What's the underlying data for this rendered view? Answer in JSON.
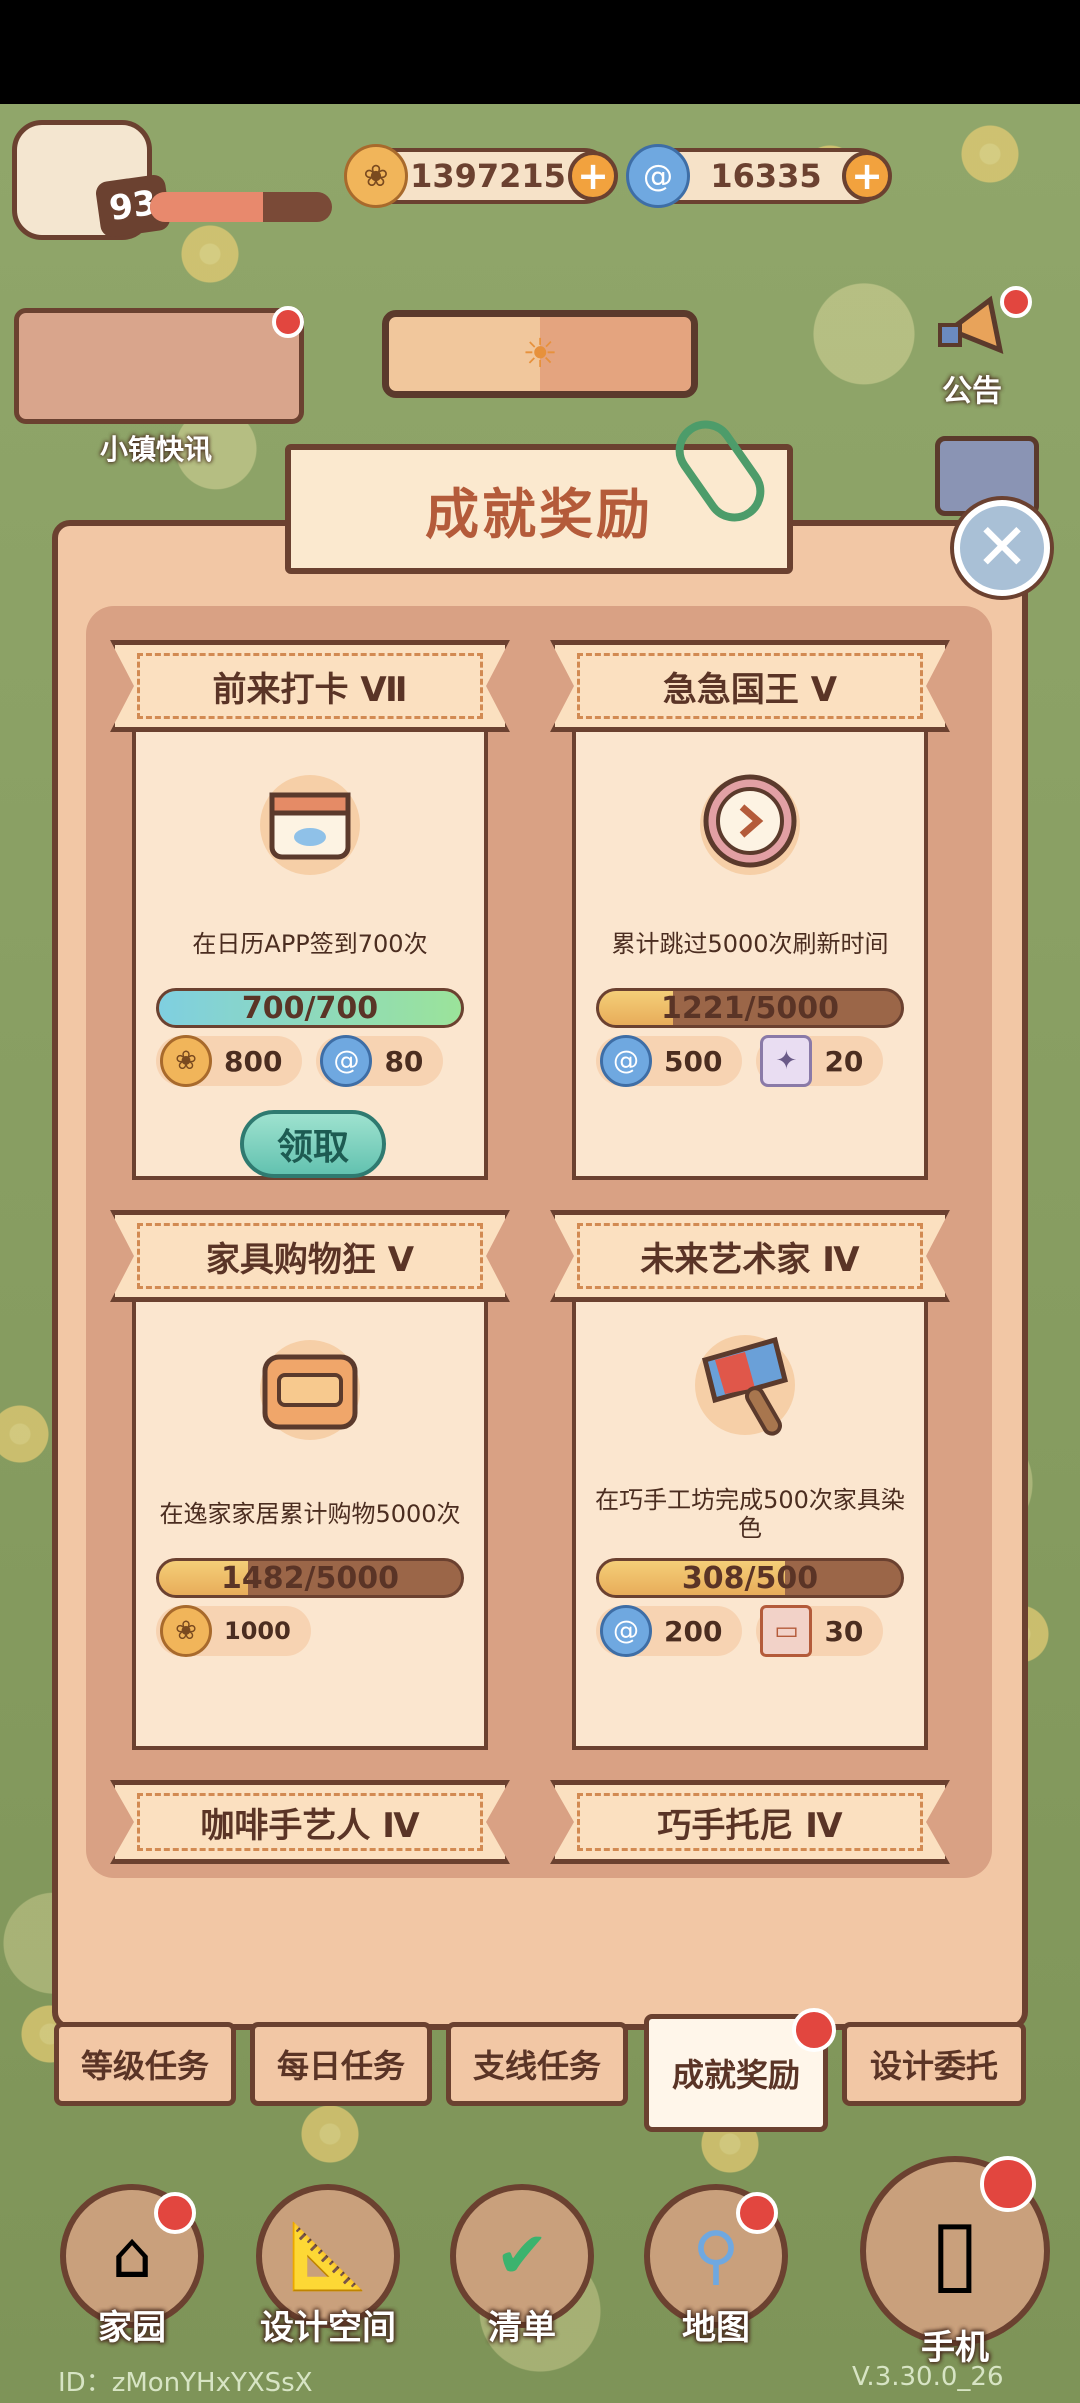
{
  "hud": {
    "level": "93",
    "xp_fraction": 0.62,
    "coins": "1397215",
    "gems": "16335",
    "plus_glyph": "+"
  },
  "side": {
    "news_label": "小镇快讯",
    "announce_label": "公告"
  },
  "panel": {
    "title": "成就奖励",
    "close_glyph": "✕"
  },
  "achievements": [
    {
      "name": "前来打卡 Ⅶ",
      "icon": "calendar-icon",
      "desc": "在日历APP签到700次",
      "progress_text": "700/700",
      "progress_fraction": 1.0,
      "completed": true,
      "rewards": [
        {
          "icon": "coin-icon",
          "amount": "800"
        },
        {
          "icon": "swirl-gem-icon",
          "amount": "80"
        }
      ],
      "claim_label": "领取"
    },
    {
      "name": "急急国王 Ⅴ",
      "icon": "clock-icon",
      "desc": "累计跳过5000次刷新时间",
      "progress_text": "1221/5000",
      "progress_fraction": 0.244,
      "completed": false,
      "rewards": [
        {
          "icon": "swirl-gem-icon",
          "amount": "500"
        },
        {
          "icon": "ticket-icon",
          "amount": "20"
        }
      ]
    },
    {
      "name": "家具购物狂 Ⅴ",
      "icon": "armchair-icon",
      "desc": "在逸家家居累计购物5000次",
      "progress_text": "1482/5000",
      "progress_fraction": 0.296,
      "completed": false,
      "rewards": [
        {
          "icon": "coin-icon",
          "amount": "1000"
        }
      ]
    },
    {
      "name": "未来艺术家 Ⅳ",
      "icon": "paintbrush-icon",
      "desc": "在巧手工坊完成500次家具染色",
      "progress_text": "308/500",
      "progress_fraction": 0.616,
      "completed": false,
      "rewards": [
        {
          "icon": "swirl-gem-icon",
          "amount": "200"
        },
        {
          "icon": "coupon-icon",
          "amount": "30"
        }
      ]
    },
    {
      "name": "咖啡手艺人 Ⅳ"
    },
    {
      "name": "巧手托尼 Ⅳ"
    }
  ],
  "tabs": [
    "等级任务",
    "每日任务",
    "支线任务",
    "成就奖励",
    "设计委托"
  ],
  "active_tab": "成就奖励",
  "nav": [
    "家园",
    "设计空间",
    "清单",
    "地图",
    "手机"
  ],
  "footer": {
    "id": "ID：zMonYHxYXSsX",
    "version": "V.3.30.0_26"
  },
  "colors": {
    "panel": "#f2c7a5",
    "border": "#6b4130",
    "title": "#b45b3a",
    "claim": "#63c2b0",
    "badge": "#e2463f"
  }
}
